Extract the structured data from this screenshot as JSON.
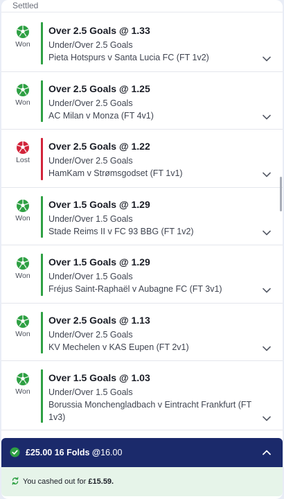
{
  "section_title": "Settled",
  "bets": [
    {
      "title": "Over 2.5 Goals @ 1.33",
      "market": "Under/Over 2.5 Goals",
      "event": "Pieta Hotspurs v Santa Lucia FC (FT 1v2)",
      "status": "Won",
      "result": "won"
    },
    {
      "title": "Over 2.5 Goals @ 1.25",
      "market": "Under/Over 2.5 Goals",
      "event": "AC Milan v Monza (FT 4v1)",
      "status": "Won",
      "result": "won"
    },
    {
      "title": "Over 2.5 Goals @ 1.22",
      "market": "Under/Over 2.5 Goals",
      "event": "HamKam v Strømsgodset (FT 1v1)",
      "status": "Lost",
      "result": "lost"
    },
    {
      "title": "Over 1.5 Goals @ 1.29",
      "market": "Under/Over 1.5 Goals",
      "event": "Stade Reims II v FC 93 BBG (FT 1v2)",
      "status": "Won",
      "result": "won"
    },
    {
      "title": "Over 1.5 Goals @ 1.29",
      "market": "Under/Over 1.5 Goals",
      "event": "Fréjus Saint-Raphaël v Aubagne FC (FT 3v1)",
      "status": "Won",
      "result": "won"
    },
    {
      "title": "Over 2.5 Goals @ 1.13",
      "market": "Under/Over 2.5 Goals",
      "event": "KV Mechelen v KAS Eupen (FT 2v1)",
      "status": "Won",
      "result": "won"
    },
    {
      "title": "Over 1.5 Goals @ 1.03",
      "market": "Under/Over 1.5 Goals",
      "event": "Borussia Monchengladbach v Eintracht Frankfurt (FT 1v3)",
      "status": "Won",
      "result": "won"
    }
  ],
  "summary": {
    "stake": "£25.00",
    "bet_type": "16 Folds",
    "odds_prefix": "@",
    "odds": "16.00"
  },
  "cashout": {
    "text": "You cashed out for",
    "amount": "£15.59."
  },
  "colors": {
    "won": "#2ea043",
    "lost": "#d2243a",
    "summary_bg": "#1b2a6b",
    "cashout_bg": "#e6f4e9"
  },
  "icons": {
    "won": "green-football-icon",
    "lost": "red-football-icon",
    "expand": "chevron-down-icon",
    "collapse": "chevron-up-icon",
    "check": "check-circle-icon",
    "cashout": "cashout-arrows-icon"
  }
}
